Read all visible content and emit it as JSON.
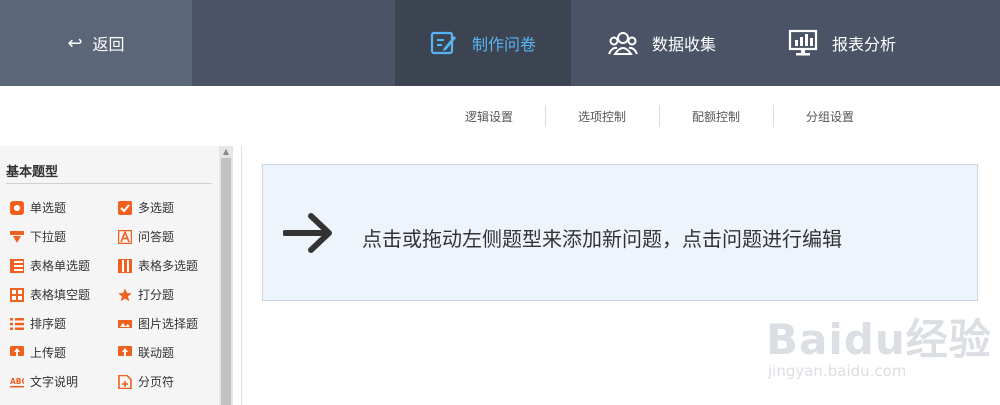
{
  "topbar": {
    "back_label": "返回",
    "tabs": [
      {
        "label": "制作问卷",
        "icon": "edit-icon",
        "active": true
      },
      {
        "label": "数据收集",
        "icon": "users-icon",
        "active": false
      },
      {
        "label": "报表分析",
        "icon": "chart-monitor-icon",
        "active": false
      }
    ]
  },
  "subbar": {
    "items": [
      "逻辑设置",
      "选项控制",
      "配额控制",
      "分组设置"
    ]
  },
  "leftpanel": {
    "section_title": "基本题型",
    "items": [
      {
        "label": "单选题",
        "icon": "radio-icon"
      },
      {
        "label": "多选题",
        "icon": "checkbox-icon"
      },
      {
        "label": "下拉题",
        "icon": "dropdown-icon"
      },
      {
        "label": "问答题",
        "icon": "text-answer-icon"
      },
      {
        "label": "表格单选题",
        "icon": "table-radio-icon"
      },
      {
        "label": "表格多选题",
        "icon": "table-checkbox-icon"
      },
      {
        "label": "表格填空题",
        "icon": "table-fill-icon"
      },
      {
        "label": "打分题",
        "icon": "star-icon"
      },
      {
        "label": "排序题",
        "icon": "sort-list-icon"
      },
      {
        "label": "图片选择题",
        "icon": "image-choice-icon"
      },
      {
        "label": "上传题",
        "icon": "upload-icon"
      },
      {
        "label": "联动题",
        "icon": "linkage-icon"
      },
      {
        "label": "文字说明",
        "icon": "abc-text-icon"
      },
      {
        "label": "分页符",
        "icon": "page-break-icon"
      }
    ]
  },
  "canvas": {
    "hint": "点击或拖动左侧题型来添加新问题，点击问题进行编辑"
  },
  "watermark": {
    "logo": "Baidu经验",
    "url": "jingyan.baidu.com"
  },
  "colors": {
    "topbar_bg": "#4a5466",
    "active_tab_bg": "#3c4452",
    "active_tab_text": "#57b4f2",
    "icon_accent": "#f0601f",
    "hint_bg": "#eef4fc"
  }
}
